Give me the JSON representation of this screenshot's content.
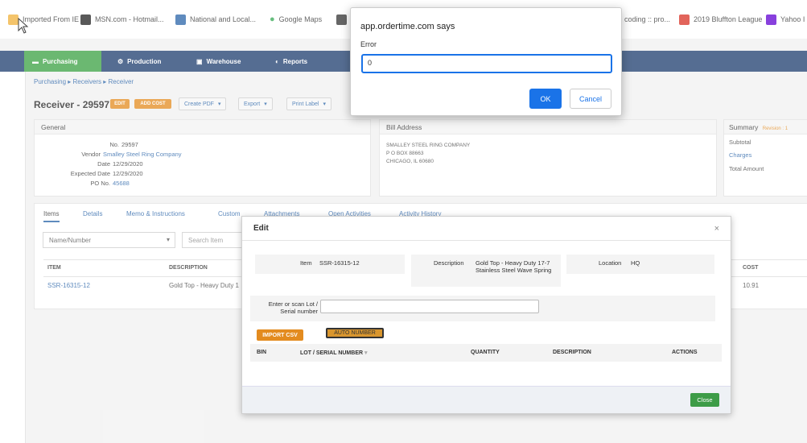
{
  "bookmarks": [
    {
      "label": "Imported From IE",
      "icon": "folder-icon",
      "color": "#f0b13a"
    },
    {
      "label": "MSN.com - Hotmail...",
      "icon": "msn-icon",
      "color": "#222222"
    },
    {
      "label": "National and Local...",
      "icon": "weather-icon",
      "color": "#2a64a8"
    },
    {
      "label": "Google Maps",
      "icon": "maps-pin-icon",
      "color": "#34a853"
    },
    {
      "label": "",
      "icon": "site-icon",
      "color": "#333333"
    },
    {
      "label": "coding :: pro...",
      "icon": "",
      "color": ""
    },
    {
      "label": "2019 Bluffton League",
      "icon": "league-icon",
      "color": "#d93025"
    },
    {
      "label": "Yahoo I",
      "icon": "yahoo-icon",
      "color": "#6001d2"
    }
  ],
  "nav": {
    "purchasing": "Purchasing",
    "production": "Production",
    "warehouse": "Warehouse",
    "reports": "Reports"
  },
  "breadcrumb": "Purchasing ▸ Receivers ▸ Receiver",
  "page_title": "Receiver - 29597",
  "actions": {
    "edit": "EDIT",
    "add_cost": "ADD COST",
    "create_pdf": "Create PDF",
    "export": "Export",
    "print_label": "Print Label"
  },
  "general": {
    "header": "General",
    "no_label": "No.",
    "no_value": "29597",
    "vendor_label": "Vendor",
    "vendor_value": "Smalley Steel Ring Company",
    "date_label": "Date",
    "date_value": "12/29/2020",
    "expected_label": "Expected Date",
    "expected_value": "12/29/2020",
    "po_label": "PO No.",
    "po_value": "45688"
  },
  "bill_address": {
    "header": "Bill Address",
    "line1": "SMALLEY STEEL RING COMPANY",
    "line2": "P O BOX 88663",
    "line3": "CHICAGO, IL 60680"
  },
  "summary": {
    "header": "Summary",
    "revision": "Revision : 1",
    "subtotal": "Subtotal",
    "charges": "Charges",
    "total": "Total Amount"
  },
  "tabs": [
    "Items",
    "Details",
    "Memo & Instructions",
    "Custom",
    "Attachments",
    "Open Activities",
    "Activity History"
  ],
  "filter": {
    "select": "Name/Number",
    "search_placeholder": "Search Item"
  },
  "items_table": {
    "headers": {
      "item": "ITEM",
      "description": "DESCRIPTION",
      "cost": "COST"
    },
    "row": {
      "item": "SSR-16315-12",
      "description": "Gold Top - Heavy Duty 1",
      "cost": "10.91"
    }
  },
  "edit_modal": {
    "title": "Edit",
    "item_label": "Item",
    "item_value": "SSR-16315-12",
    "description_label": "Description",
    "description_value": "Gold Top - Heavy Duty 17-7 Stainless Steel Wave Spring",
    "location_label": "Location",
    "location_value": "HQ",
    "lot_label": "Enter or scan Lot / Serial number",
    "import_csv": "IMPORT CSV",
    "auto_number": "AUTO NUMBER",
    "headers": {
      "bin": "BIN",
      "lot": "LOT / SERIAL NUMBER",
      "quantity": "QUANTITY",
      "description": "DESCRIPTION",
      "actions": "ACTIONS"
    },
    "close": "Close"
  },
  "alert": {
    "title": "app.ordertime.com says",
    "message": "Error",
    "input_value": "0",
    "ok": "OK",
    "cancel": "Cancel"
  }
}
